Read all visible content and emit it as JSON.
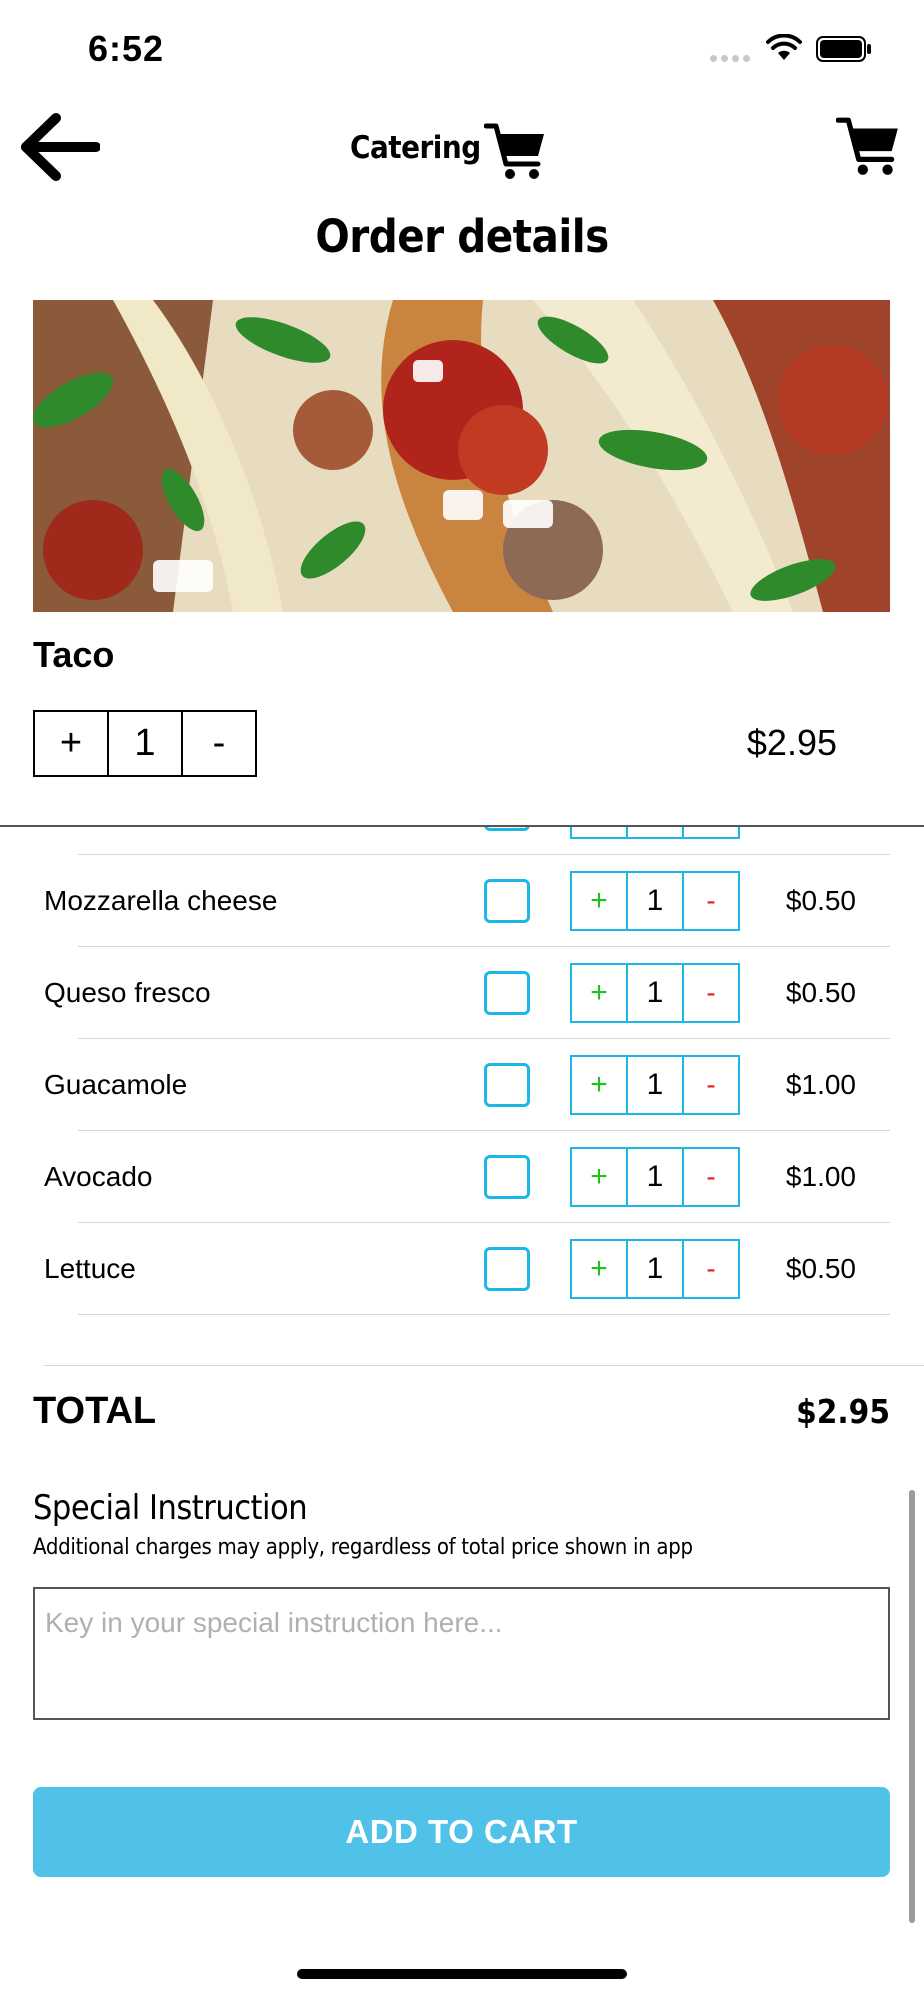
{
  "status_bar": {
    "time": "6:52"
  },
  "header": {
    "title": "Catering",
    "page_title": "Order details"
  },
  "item": {
    "name": "Taco",
    "quantity": "1",
    "plus": "+",
    "minus": "-",
    "price": "$2.95"
  },
  "options": [
    {
      "label": "Mozzarella cheese",
      "qty": "1",
      "plus": "+",
      "minus": "-",
      "price": "$0.50",
      "checked": false
    },
    {
      "label": "Queso fresco",
      "qty": "1",
      "plus": "+",
      "minus": "-",
      "price": "$0.50",
      "checked": false
    },
    {
      "label": "Guacamole",
      "qty": "1",
      "plus": "+",
      "minus": "-",
      "price": "$1.00",
      "checked": false
    },
    {
      "label": "Avocado",
      "qty": "1",
      "plus": "+",
      "minus": "-",
      "price": "$1.00",
      "checked": false
    },
    {
      "label": "Lettuce",
      "qty": "1",
      "plus": "+",
      "minus": "-",
      "price": "$0.50",
      "checked": false
    }
  ],
  "total": {
    "label": "TOTAL",
    "value": "$2.95"
  },
  "special_instruction": {
    "title": "Special Instruction",
    "note": "Additional charges may apply, regardless of total price shown in app",
    "placeholder": "Key in your special instruction here...",
    "value": ""
  },
  "add_to_cart_label": "ADD TO CART",
  "colors": {
    "accent": "#50c1e8",
    "checkbox_border": "#1bb7e6",
    "plus": "#20c020",
    "minus": "#e02020"
  },
  "icons": [
    "back-arrow-icon",
    "cart-icon",
    "wifi-icon",
    "battery-icon"
  ]
}
